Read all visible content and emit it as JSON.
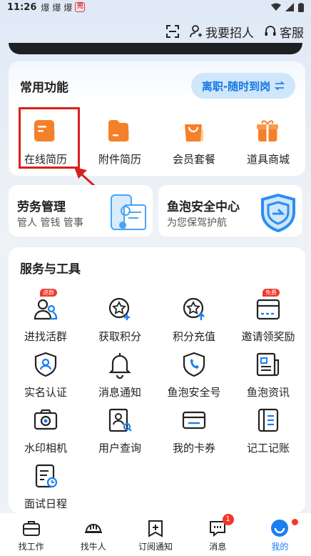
{
  "status_bar": {
    "time": "11:26",
    "notif_glyphs": [
      "爆",
      "爆",
      "爆"
    ],
    "badge": "兜"
  },
  "header": {
    "recruit_label": "我要招人",
    "service_label": "客服"
  },
  "common": {
    "title": "常用功能",
    "quit_pill": "离职-随时到岗",
    "items": [
      {
        "label": "在线简历",
        "icon": "online-resume-icon"
      },
      {
        "label": "附件简历",
        "icon": "attachment-resume-icon"
      },
      {
        "label": "会员套餐",
        "icon": "member-package-icon"
      },
      {
        "label": "道具商城",
        "icon": "prop-mall-icon"
      }
    ]
  },
  "labor": {
    "title": "劳务管理",
    "subtitle": "管人 管钱 管事"
  },
  "security": {
    "title": "鱼泡安全中心",
    "subtitle": "为您保驾护航"
  },
  "services": {
    "title": "服务与工具",
    "items": [
      {
        "label": "进找活群",
        "tag": "进群"
      },
      {
        "label": "获取积分"
      },
      {
        "label": "积分充值"
      },
      {
        "label": "邀请领奖励",
        "tag": "免费"
      },
      {
        "label": "实名认证"
      },
      {
        "label": "消息通知"
      },
      {
        "label": "鱼泡安全号"
      },
      {
        "label": "鱼泡资讯"
      },
      {
        "label": "水印相机"
      },
      {
        "label": "用户查询"
      },
      {
        "label": "我的卡券"
      },
      {
        "label": "记工记账"
      },
      {
        "label": "面试日程"
      }
    ]
  },
  "bottom_nav": [
    {
      "label": "找工作"
    },
    {
      "label": "找牛人"
    },
    {
      "label": "订阅通知"
    },
    {
      "label": "消息",
      "badge": "1"
    },
    {
      "label": "我的",
      "active": true
    }
  ],
  "colors": {
    "accent": "#1a7ff1",
    "orange": "#f5802a",
    "highlight_red": "#d8201f"
  }
}
